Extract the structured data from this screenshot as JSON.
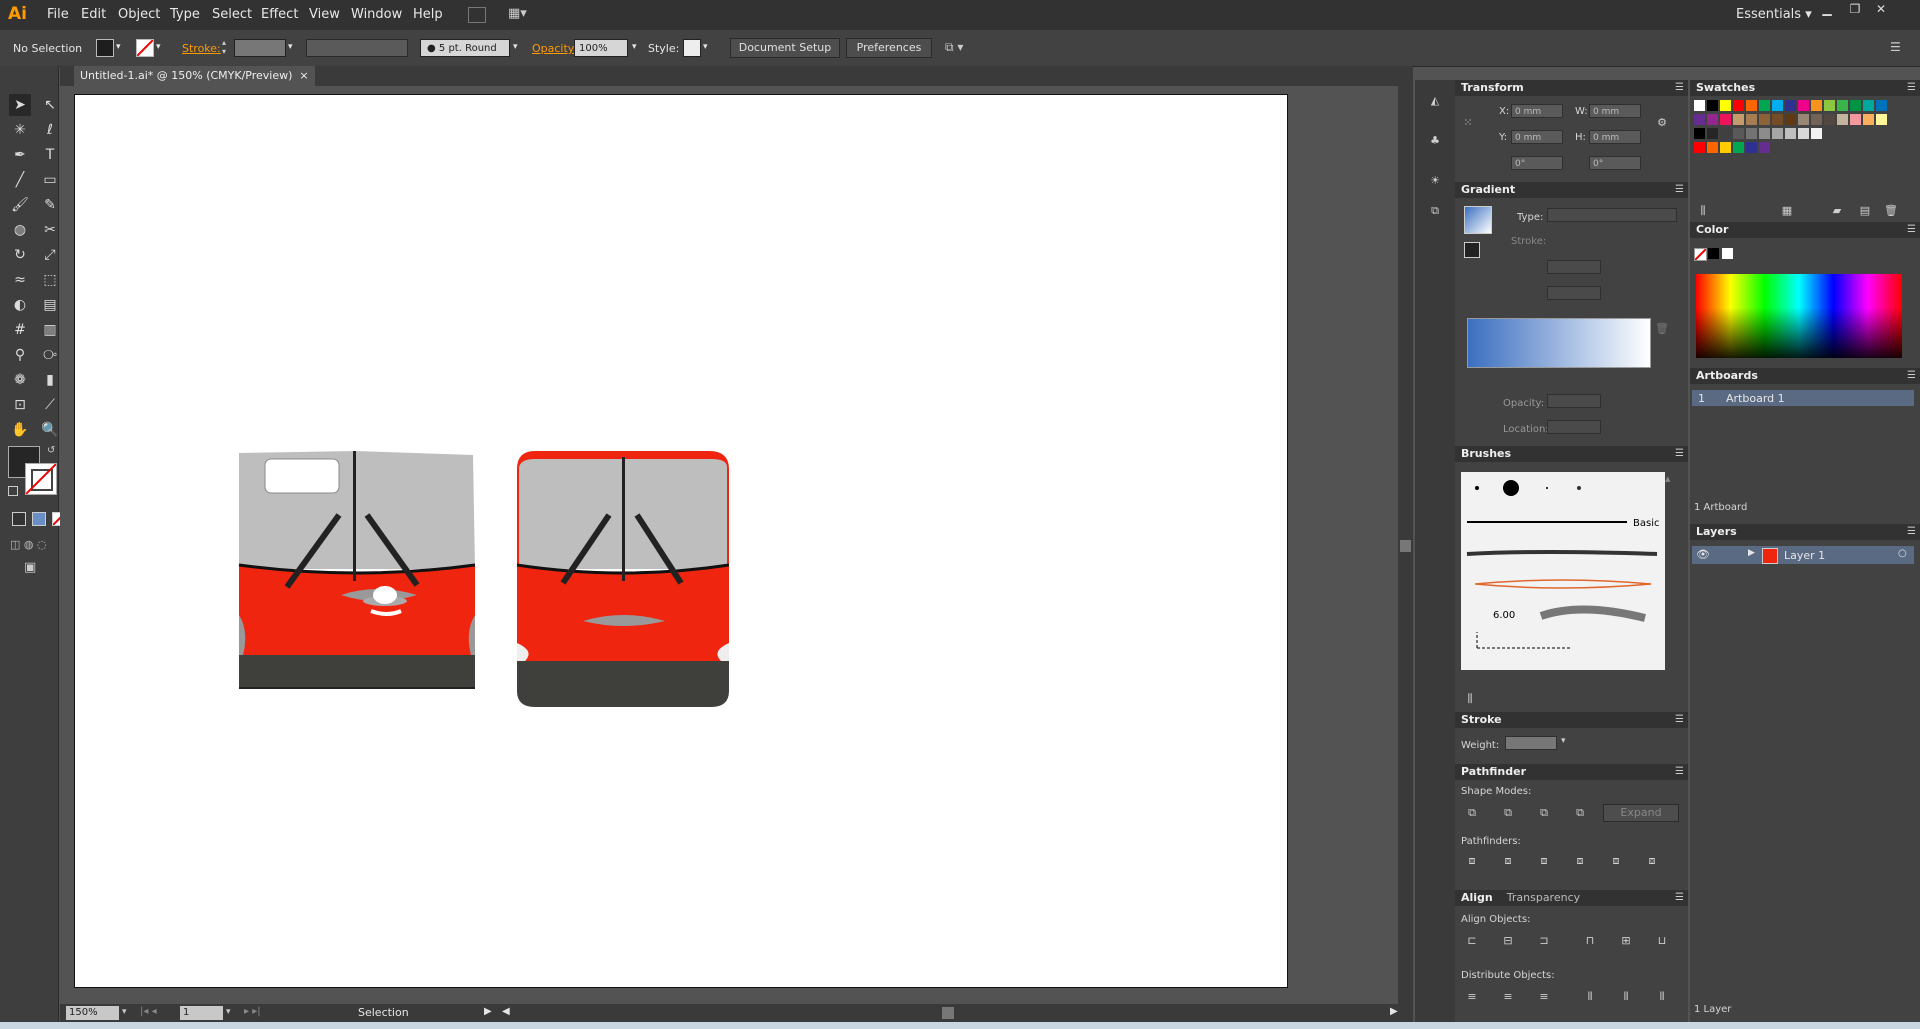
{
  "app": {
    "logo": "Ai"
  },
  "menubar": {
    "items": [
      "File",
      "Edit",
      "Object",
      "Type",
      "Select",
      "Effect",
      "View",
      "Window",
      "Help"
    ],
    "workspace": "Essentials"
  },
  "controlbar": {
    "selection": "No Selection",
    "stroke_label": "Stroke:",
    "brush": "5 pt. Round",
    "opacity_label": "Opacity:",
    "opacity_value": "100%",
    "style_label": "Style:",
    "document_setup": "Document Setup",
    "preferences": "Preferences"
  },
  "document": {
    "tab_title": "Untitled-1.ai* @ 150% (CMYK/Preview)"
  },
  "statusbar": {
    "zoom": "150%",
    "artboard_number": "1",
    "tool": "Selection"
  },
  "transform": {
    "title": "Transform",
    "x_label": "X:",
    "x_value": "0 mm",
    "y_label": "Y:",
    "y_value": "0 mm",
    "w_label": "W:",
    "w_value": "0 mm",
    "h_label": "H:",
    "h_value": "0 mm",
    "rotate": "0°",
    "shear": "0°"
  },
  "gradient": {
    "title": "Gradient",
    "type_label": "Type:",
    "stroke_label": "Stroke:",
    "opacity_label": "Opacity:",
    "location_label": "Location:",
    "start_color": "#3a6fc0"
  },
  "brushes": {
    "title": "Brushes",
    "basic_label": "Basic",
    "size": "6.00"
  },
  "stroke_panel": {
    "title": "Stroke",
    "weight_label": "Weight:"
  },
  "pathfinder": {
    "title": "Pathfinder",
    "shape_modes": "Shape Modes:",
    "pathfinders": "Pathfinders:",
    "expand": "Expand"
  },
  "align": {
    "title": "Align",
    "tab2": "Transparency",
    "align_objects": "Align Objects:",
    "distribute_objects": "Distribute Objects:"
  },
  "swatches": {
    "title": "Swatches",
    "colors": [
      "#ffffff",
      "#000000",
      "#ffff00",
      "#ff0000",
      "#ff6600",
      "#00a651",
      "#00aeef",
      "#2e3192",
      "#ec008c",
      "#f7941d",
      "#8dc63f",
      "#39b54a",
      "#009444",
      "#00a99d",
      "#0072bc",
      "#662d91",
      "#92278f",
      "#ed145b",
      "#c69c6d",
      "#a67c52",
      "#8c6239",
      "#754c24",
      "#603913",
      "#998675",
      "#736357",
      "#534741",
      "#c2b59b",
      "#f5989d",
      "#fbaf5d",
      "#fff799"
    ],
    "grays": [
      "#000000",
      "#262626",
      "#404040",
      "#595959",
      "#737373",
      "#8c8c8c",
      "#a6a6a6",
      "#bfbfbf",
      "#d9d9d9",
      "#f2f2f2"
    ],
    "group": [
      "#ff0000",
      "#ff6600",
      "#ffcc00",
      "#00a651",
      "#2e3192",
      "#662d91"
    ]
  },
  "color_panel": {
    "title": "Color"
  },
  "artboards": {
    "title": "Artboards",
    "row_number": "1",
    "row_name": "Artboard 1",
    "count": "1 Artboard"
  },
  "layers": {
    "title": "Layers",
    "layer_name": "Layer 1",
    "count": "1 Layer"
  },
  "artwork": {
    "bus_red": "#f0250f",
    "bus_gray": "#bebebe",
    "bus_dark": "#3f3f3c"
  }
}
